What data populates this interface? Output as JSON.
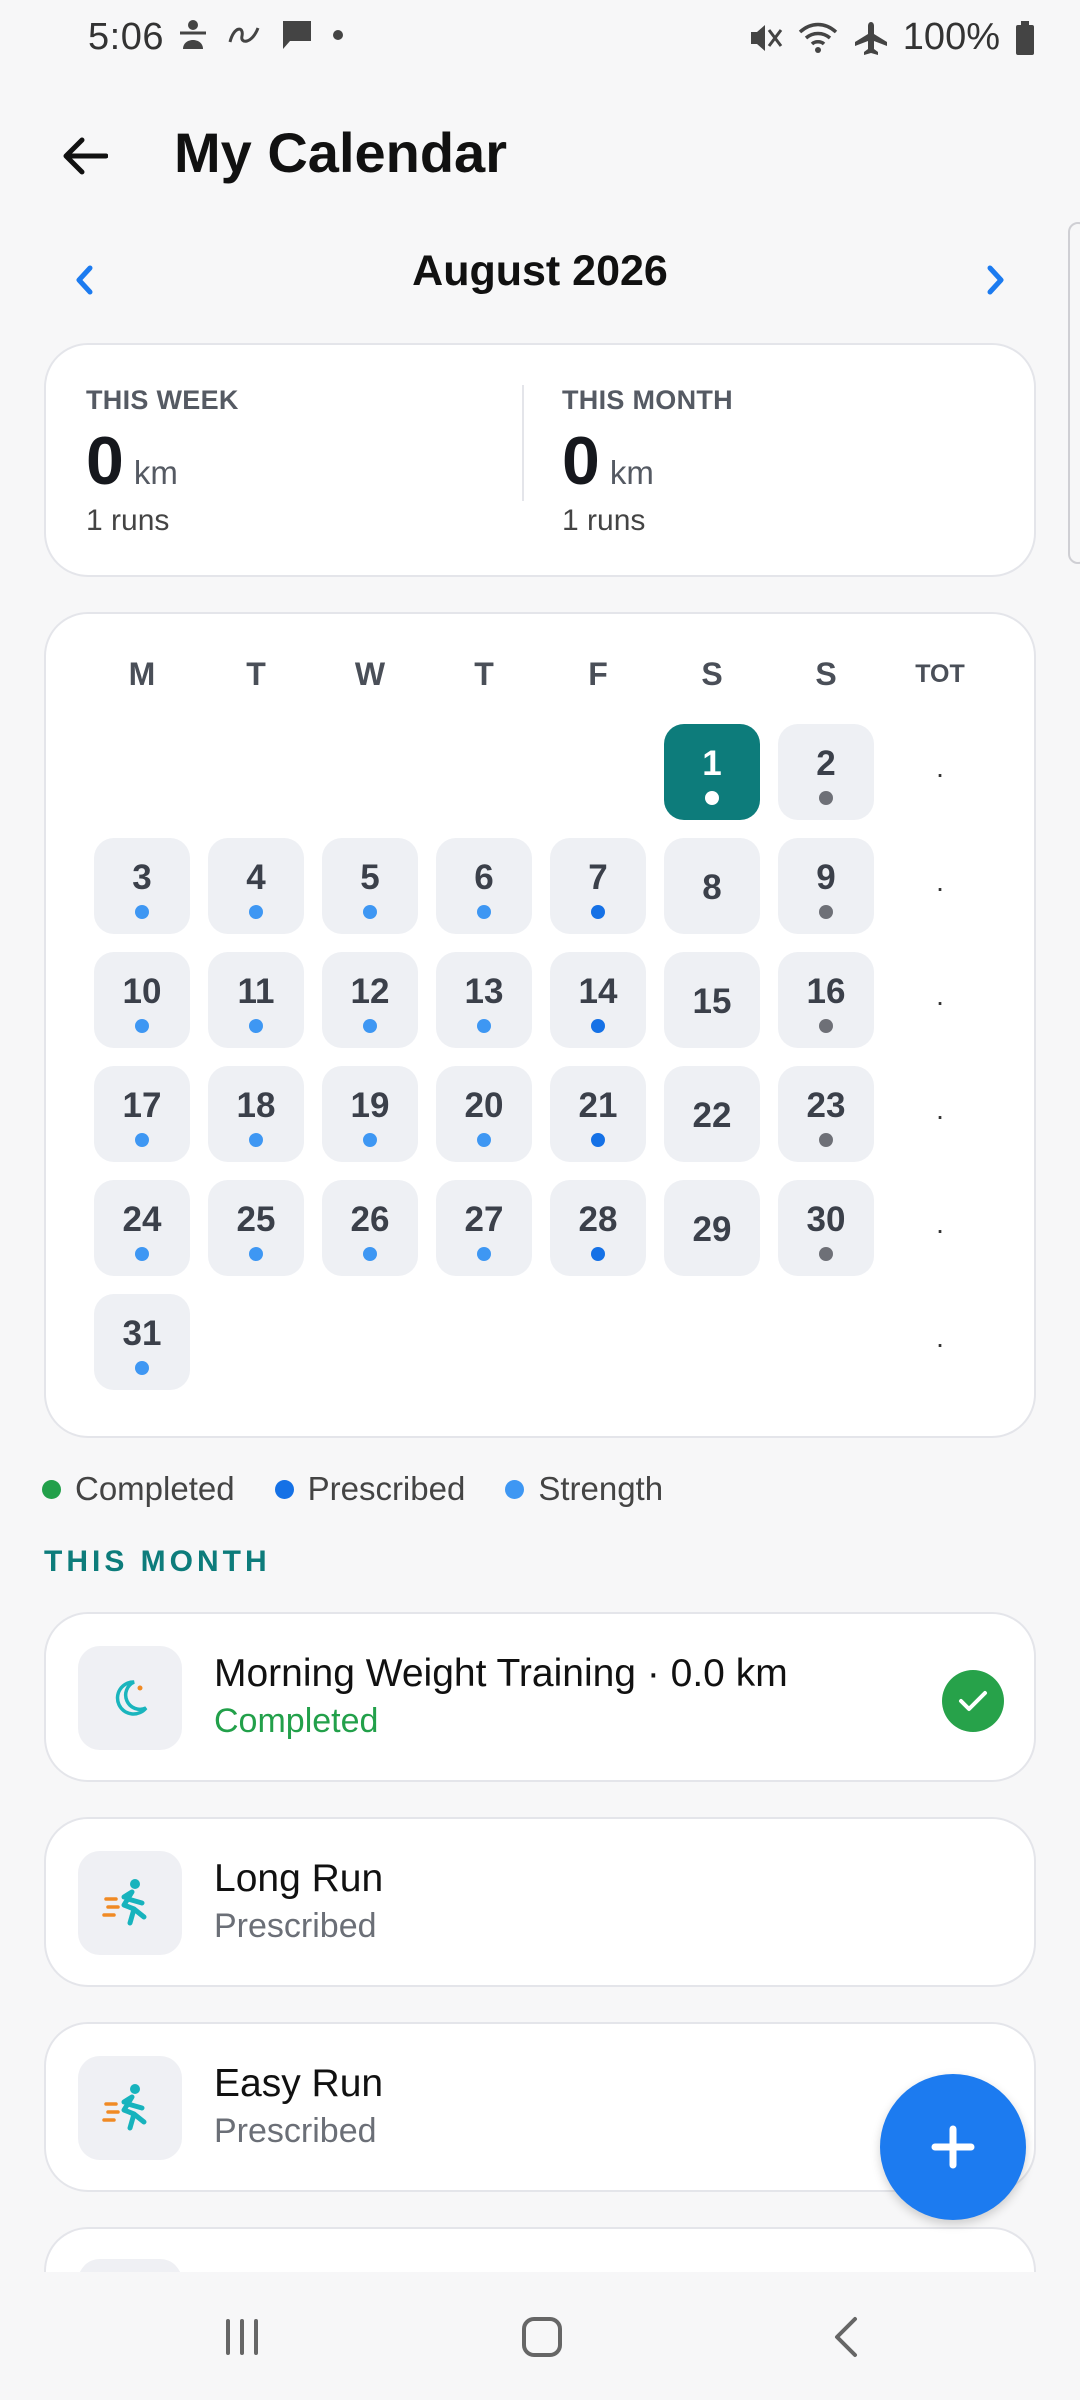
{
  "status_bar": {
    "time": "5:06",
    "battery": "100%"
  },
  "header": {
    "title": "My Calendar"
  },
  "month_nav": {
    "month": "August 2026"
  },
  "summary": {
    "week": {
      "label": "THIS WEEK",
      "value": "0",
      "unit": "km",
      "runs": "1 runs"
    },
    "month": {
      "label": "THIS MONTH",
      "value": "0",
      "unit": "km",
      "runs": "1 runs"
    }
  },
  "calendar": {
    "weekdays": [
      "M",
      "T",
      "W",
      "T",
      "F",
      "S",
      "S"
    ],
    "total_label": "TOT",
    "week_totals": [
      ".",
      ".",
      ".",
      ".",
      ".",
      "."
    ],
    "days": [
      {
        "day": "1",
        "dot": "today"
      },
      {
        "day": "2",
        "dot": "gray"
      },
      {
        "day": "3",
        "dot": "light"
      },
      {
        "day": "4",
        "dot": "light"
      },
      {
        "day": "5",
        "dot": "light"
      },
      {
        "day": "6",
        "dot": "light"
      },
      {
        "day": "7",
        "dot": "blue"
      },
      {
        "day": "8",
        "dot": "none"
      },
      {
        "day": "9",
        "dot": "gray"
      },
      {
        "day": "10",
        "dot": "light"
      },
      {
        "day": "11",
        "dot": "light"
      },
      {
        "day": "12",
        "dot": "light"
      },
      {
        "day": "13",
        "dot": "light"
      },
      {
        "day": "14",
        "dot": "blue"
      },
      {
        "day": "15",
        "dot": "none"
      },
      {
        "day": "16",
        "dot": "gray"
      },
      {
        "day": "17",
        "dot": "light"
      },
      {
        "day": "18",
        "dot": "light"
      },
      {
        "day": "19",
        "dot": "light"
      },
      {
        "day": "20",
        "dot": "light"
      },
      {
        "day": "21",
        "dot": "blue"
      },
      {
        "day": "22",
        "dot": "none"
      },
      {
        "day": "23",
        "dot": "gray"
      },
      {
        "day": "24",
        "dot": "light"
      },
      {
        "day": "25",
        "dot": "light"
      },
      {
        "day": "26",
        "dot": "light"
      },
      {
        "day": "27",
        "dot": "light"
      },
      {
        "day": "28",
        "dot": "blue"
      },
      {
        "day": "29",
        "dot": "none"
      },
      {
        "day": "30",
        "dot": "gray"
      },
      {
        "day": "31",
        "dot": "light"
      }
    ],
    "first_weekday_index": 5,
    "dot_colors": {
      "light": "#3e97f3",
      "blue": "#1571e6",
      "gray": "#6e7077",
      "today": "#ffffff"
    }
  },
  "legend": [
    {
      "label": "Completed",
      "color": "#22a04a"
    },
    {
      "label": "Prescribed",
      "color": "#1571e6"
    },
    {
      "label": "Strength",
      "color": "#3e97f3"
    }
  ],
  "section_title": "THIS MONTH",
  "workouts": [
    {
      "title": "Morning Weight Training · 0.0 km",
      "status": "Completed",
      "icon": "moon-icon",
      "completed": true
    },
    {
      "title": "Long Run",
      "status": "Prescribed",
      "icon": "runner-icon",
      "completed": false
    },
    {
      "title": "Easy Run",
      "status": "Prescribed",
      "icon": "runner-icon",
      "completed": false
    }
  ],
  "colors": {
    "accent": "#0d7c7b",
    "fab": "#1c7bf0",
    "completed": "#27a24a"
  }
}
